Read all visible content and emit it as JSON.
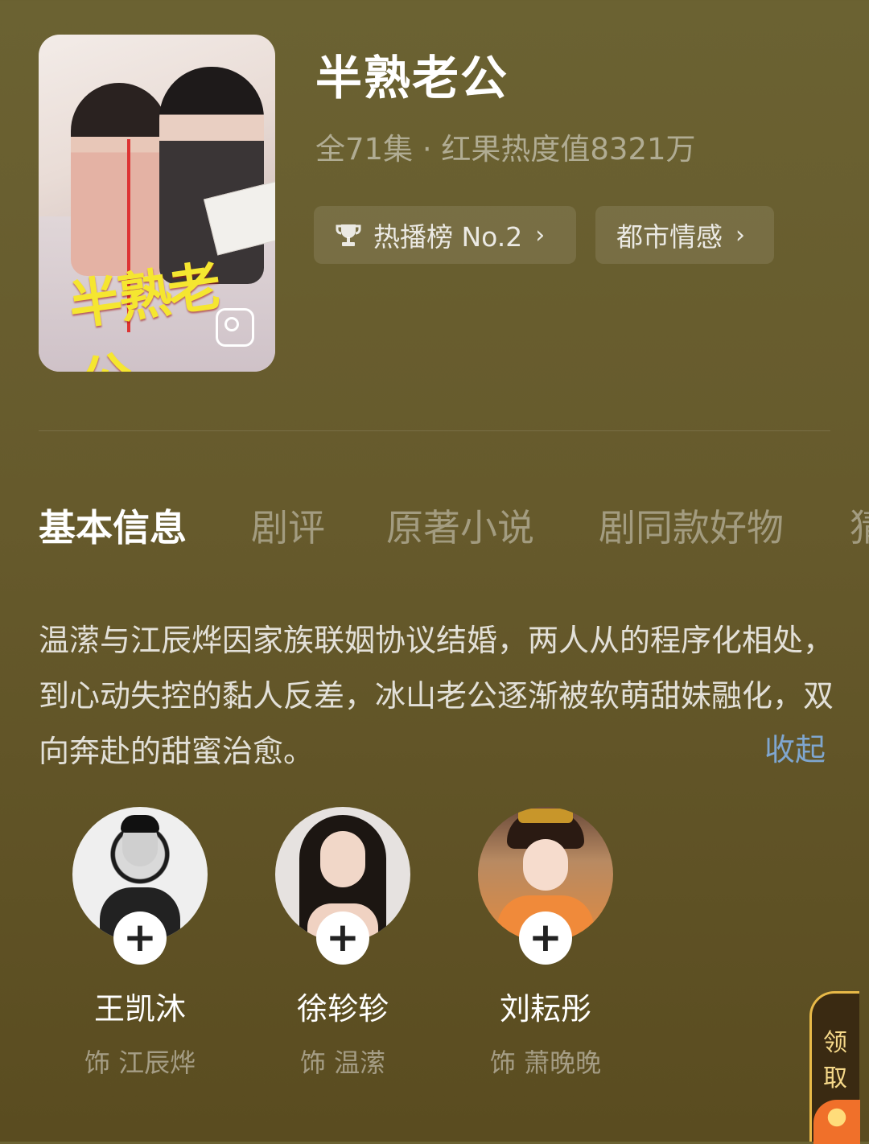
{
  "drama": {
    "title": "半熟老公",
    "meta": "全71集 · 红果热度值8321万",
    "rank_label": "热播榜 No.2",
    "genre_label": "都市情感",
    "poster_title_art": "半熟老公"
  },
  "tabs": [
    {
      "label": "基本信息",
      "active": true
    },
    {
      "label": "剧评",
      "active": false
    },
    {
      "label": "原著小说",
      "active": false
    },
    {
      "label": "剧同款好物",
      "active": false
    },
    {
      "label": "猜",
      "active": false
    }
  ],
  "synopsis": {
    "text": "温潆与江辰烨因家族联姻协议结婚，两人从的程序化相处，到心动失控的黏人反差，冰山老公逐渐被软萌甜妹融化，双向奔赴的甜蜜治愈。",
    "collapse_label": "收起"
  },
  "cast": [
    {
      "name": "王凯沐",
      "role": "饰 江辰烨"
    },
    {
      "name": "徐轸轸",
      "role": "饰 温潆"
    },
    {
      "name": "刘耘彤",
      "role": "饰 萧晚晚"
    }
  ],
  "reward": {
    "label": "领取"
  },
  "icons": {
    "chevron": "chevron-right-icon",
    "trophy": "trophy-icon",
    "follow": "plus-icon",
    "gallery": "gallery-icon"
  },
  "colors": {
    "link": "#7fa6cf",
    "reward_border": "#e8b948"
  }
}
